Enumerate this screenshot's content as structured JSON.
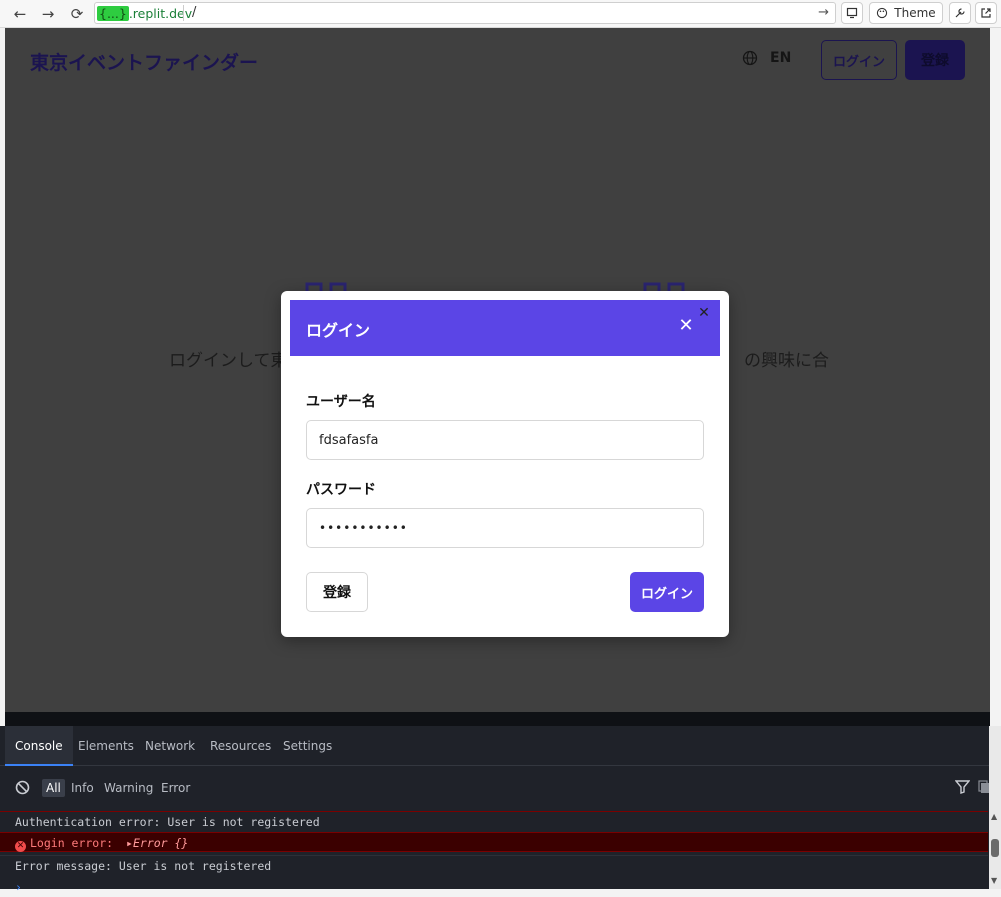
{
  "browser": {
    "url_host_highlight": "{...}",
    "url_host_suffix": ".replit.dev",
    "url_path": "/",
    "theme_label": "Theme"
  },
  "header": {
    "site_title": "東京イベントファインダー",
    "lang_label": "EN",
    "login_label": "ログイン",
    "register_label": "登録"
  },
  "hero": {
    "subtitle_left": "ログインして東",
    "subtitle_right": "の興味に合"
  },
  "modal": {
    "title": "ログイン",
    "username_label": "ユーザー名",
    "username_value": "fdsafasfa",
    "password_label": "パスワード",
    "password_value": "•••••••••••",
    "register_label": "登録",
    "login_label": "ログイン"
  },
  "devtools": {
    "tabs": [
      "Console",
      "Elements",
      "Network",
      "Resources",
      "Settings"
    ],
    "filters": [
      "All",
      "Info",
      "Warning",
      "Error"
    ],
    "logs": {
      "auth_error": "Authentication error: User is not registered",
      "login_error_label": "Login error:",
      "login_error_obj": "Error {}",
      "error_message": "Error message: User is not registered"
    }
  },
  "colors": {
    "accent": "#5b45e6",
    "brand_dark": "#1b1450",
    "overlay": "#404040"
  }
}
